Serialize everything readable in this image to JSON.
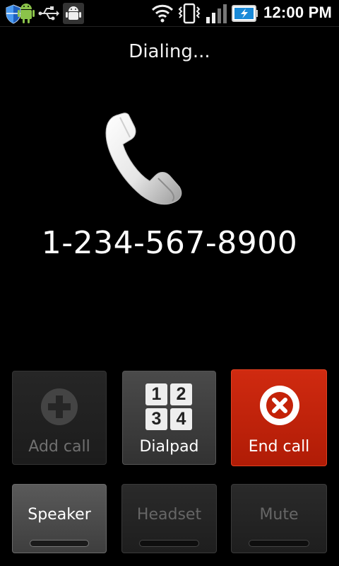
{
  "status_bar": {
    "time": "12:00 PM",
    "icons": [
      "shield-icon",
      "android-icon",
      "usb-icon",
      "android-debug-icon",
      "wifi-icon",
      "vibrate-icon",
      "signal-icon",
      "battery-charging-icon"
    ]
  },
  "call": {
    "status": "Dialing...",
    "number": "1-234-567-8900"
  },
  "dialpad_keys": [
    "1",
    "2",
    "3",
    "4"
  ],
  "buttons": {
    "add_call": "Add call",
    "dialpad": "Dialpad",
    "end_call": "End call",
    "speaker": "Speaker",
    "headset": "Headset",
    "mute": "Mute"
  },
  "colors": {
    "end_call": "#c42208",
    "background": "#000000",
    "status_accent": "#3399ff"
  }
}
